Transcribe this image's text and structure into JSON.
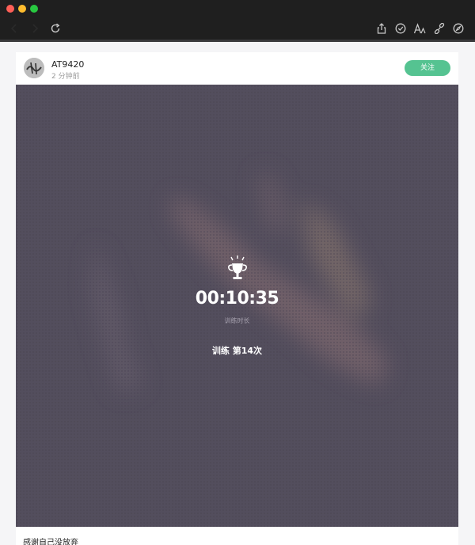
{
  "window": {
    "controls": [
      "close",
      "minimize",
      "zoom"
    ]
  },
  "toolbar": {
    "icons": [
      "back-icon",
      "forward-icon",
      "reload-icon",
      "share-icon",
      "check-circle-icon",
      "font-icon",
      "link-icon",
      "compass-icon"
    ]
  },
  "post": {
    "username": "AT9420",
    "time": "2 分钟前",
    "follow_label": "关注",
    "follow_color": "#55c391",
    "duration": "00:10:35",
    "duration_label": "训练时长",
    "session": "训练 第14次",
    "caption": "感谢自己没放弃",
    "hero_bg_color": "#534e5d"
  }
}
